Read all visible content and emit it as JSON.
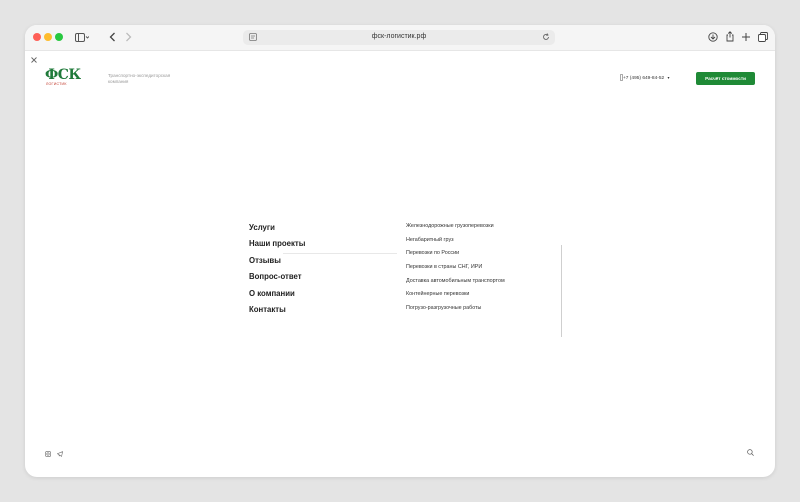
{
  "browser": {
    "url": "фск-логистик.рф"
  },
  "header": {
    "logo_text": "ФСК",
    "logo_subtext": "ЛОГИСТИК",
    "tagline": "Транспортно-экспедиторская компания",
    "phone": "+7 (495) 649-84-52",
    "cta_label": "Расчёт стоимости"
  },
  "menu": {
    "items": [
      "Услуги",
      "Наши проекты",
      "Отзывы",
      "Вопрос-ответ",
      "О компании",
      "Контакты"
    ]
  },
  "services": {
    "items": [
      "Железнодорожные грузоперевозки",
      "Негабаритный груз",
      "Перевозки по России",
      "Перевозки в страны СНГ, ИРИ",
      "Доставка автомобильным транспортом",
      "Контейнерные перевозки",
      "Погрузо-разгрузочные работы"
    ]
  },
  "colors": {
    "accent": "#1f8a36",
    "logo_green": "#1f7a3a",
    "logo_red": "#c0392b"
  }
}
